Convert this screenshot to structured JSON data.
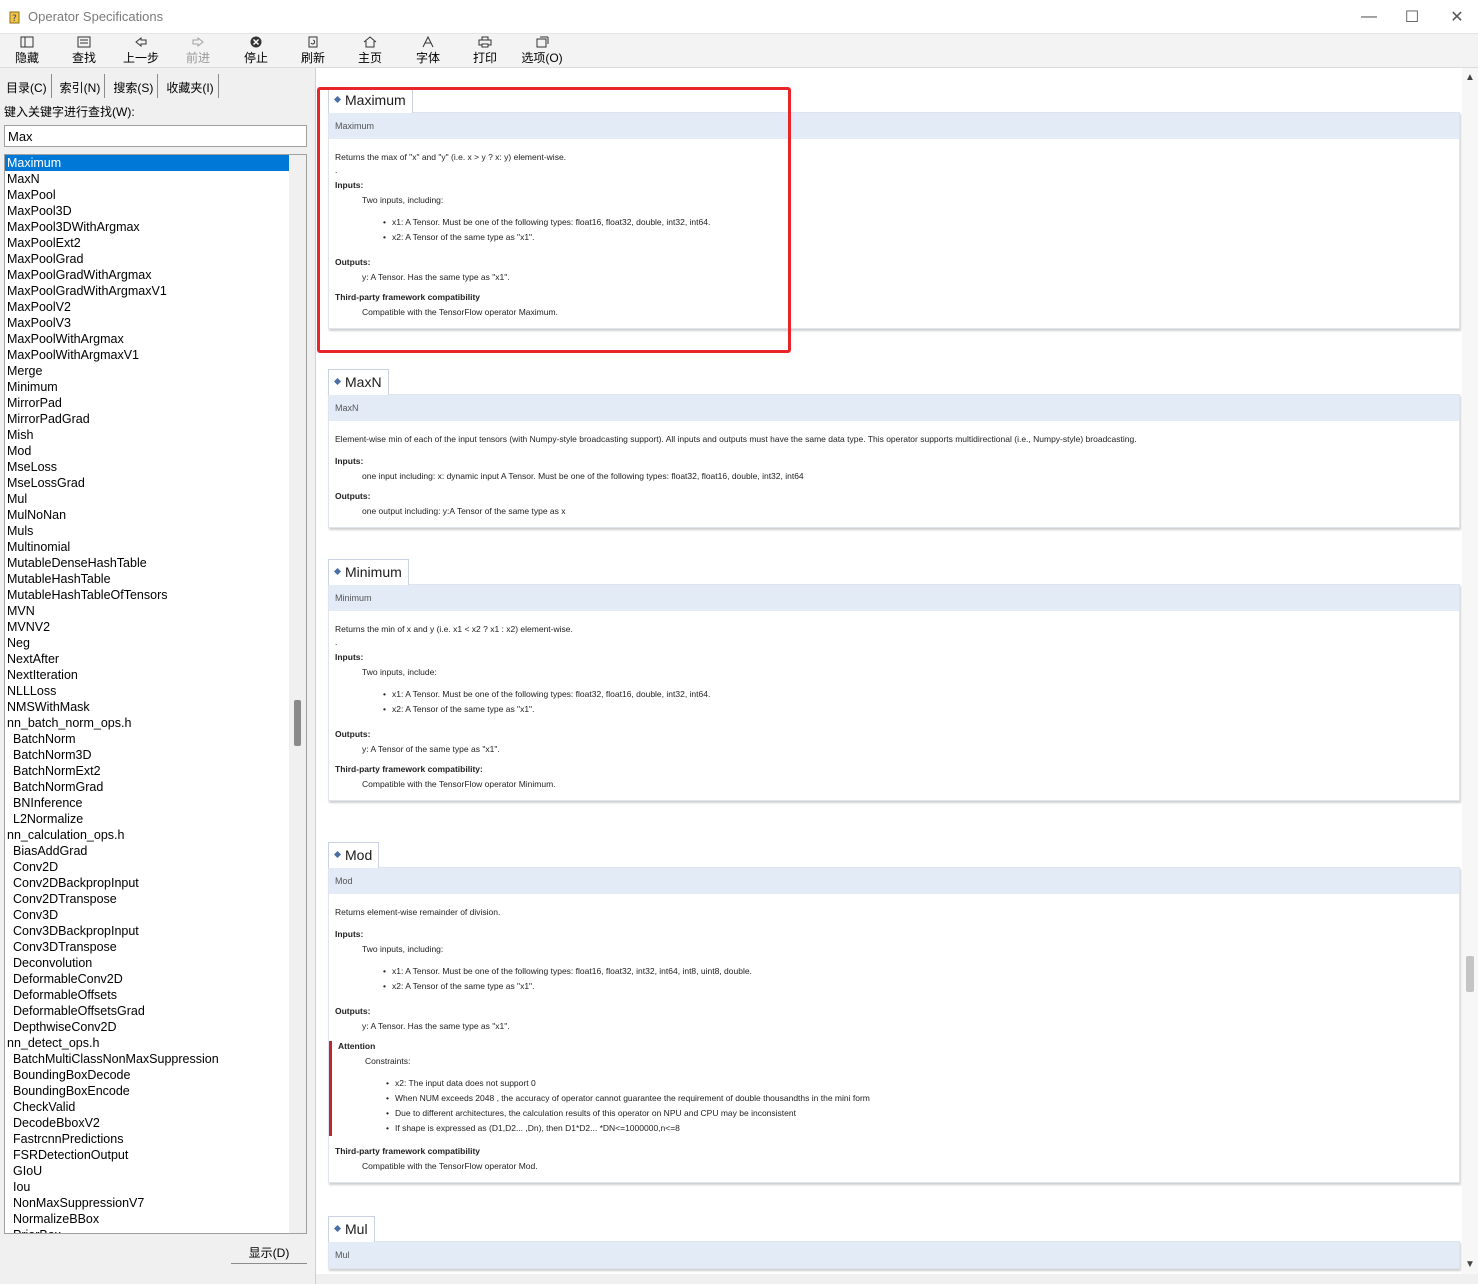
{
  "window": {
    "title": "Operator Specifications",
    "controls": {
      "minimize": "—",
      "maximize": "☐",
      "close": "✕"
    }
  },
  "toolbar": {
    "hide": "隐藏",
    "find": "查找",
    "back": "上一步",
    "forward": "前进",
    "stop": "停止",
    "refresh": "刷新",
    "home": "主页",
    "font": "字体",
    "print": "打印",
    "options": "选项(O)"
  },
  "leftpanel": {
    "tabs": [
      "目录(C)",
      "索引(N)",
      "搜索(S)",
      "收藏夹(I)"
    ],
    "keyword_label": "键入关键字进行查找(W):",
    "search_value": "Max",
    "show_button": "显示(D)",
    "items": [
      {
        "label": "Maximum",
        "selected": true
      },
      {
        "label": "MaxN"
      },
      {
        "label": "MaxPool"
      },
      {
        "label": "MaxPool3D"
      },
      {
        "label": "MaxPool3DWithArgmax"
      },
      {
        "label": "MaxPoolExt2"
      },
      {
        "label": "MaxPoolGrad"
      },
      {
        "label": "MaxPoolGradWithArgmax"
      },
      {
        "label": "MaxPoolGradWithArgmaxV1"
      },
      {
        "label": "MaxPoolV2"
      },
      {
        "label": "MaxPoolV3"
      },
      {
        "label": "MaxPoolWithArgmax"
      },
      {
        "label": "MaxPoolWithArgmaxV1"
      },
      {
        "label": "Merge"
      },
      {
        "label": "Minimum"
      },
      {
        "label": "MirrorPad"
      },
      {
        "label": "MirrorPadGrad"
      },
      {
        "label": "Mish"
      },
      {
        "label": "Mod"
      },
      {
        "label": "MseLoss"
      },
      {
        "label": "MseLossGrad"
      },
      {
        "label": "Mul"
      },
      {
        "label": "MulNoNan"
      },
      {
        "label": "Muls"
      },
      {
        "label": "Multinomial"
      },
      {
        "label": "MutableDenseHashTable"
      },
      {
        "label": "MutableHashTable"
      },
      {
        "label": "MutableHashTableOfTensors"
      },
      {
        "label": "MVN"
      },
      {
        "label": "MVNV2"
      },
      {
        "label": "Neg"
      },
      {
        "label": "NextAfter"
      },
      {
        "label": "NextIteration"
      },
      {
        "label": "NLLLoss"
      },
      {
        "label": "NMSWithMask"
      },
      {
        "label": "nn_batch_norm_ops.h"
      },
      {
        "label": "BatchNorm",
        "sub": true
      },
      {
        "label": "BatchNorm3D",
        "sub": true
      },
      {
        "label": "BatchNormExt2",
        "sub": true
      },
      {
        "label": "BatchNormGrad",
        "sub": true
      },
      {
        "label": "BNInference",
        "sub": true
      },
      {
        "label": "L2Normalize",
        "sub": true
      },
      {
        "label": "nn_calculation_ops.h"
      },
      {
        "label": "BiasAddGrad",
        "sub": true
      },
      {
        "label": "Conv2D",
        "sub": true
      },
      {
        "label": "Conv2DBackpropInput",
        "sub": true
      },
      {
        "label": "Conv2DTranspose",
        "sub": true
      },
      {
        "label": "Conv3D",
        "sub": true
      },
      {
        "label": "Conv3DBackpropInput",
        "sub": true
      },
      {
        "label": "Conv3DTranspose",
        "sub": true
      },
      {
        "label": "Deconvolution",
        "sub": true
      },
      {
        "label": "DeformableConv2D",
        "sub": true
      },
      {
        "label": "DeformableOffsets",
        "sub": true
      },
      {
        "label": "DeformableOffsetsGrad",
        "sub": true
      },
      {
        "label": "DepthwiseConv2D",
        "sub": true
      },
      {
        "label": "nn_detect_ops.h"
      },
      {
        "label": "BatchMultiClassNonMaxSuppression",
        "sub": true
      },
      {
        "label": "BoundingBoxDecode",
        "sub": true
      },
      {
        "label": "BoundingBoxEncode",
        "sub": true
      },
      {
        "label": "CheckValid",
        "sub": true
      },
      {
        "label": "DecodeBboxV2",
        "sub": true
      },
      {
        "label": "FastrcnnPredictions",
        "sub": true
      },
      {
        "label": "FSRDetectionOutput",
        "sub": true
      },
      {
        "label": "GIoU",
        "sub": true
      },
      {
        "label": "Iou",
        "sub": true
      },
      {
        "label": "NonMaxSuppressionV7",
        "sub": true
      },
      {
        "label": "NormalizeBBox",
        "sub": true
      },
      {
        "label": "PriorBox",
        "sub": true
      }
    ]
  },
  "content": {
    "maximum": {
      "tab": "Maximum",
      "head": "Maximum",
      "desc": "Returns the max of \"x\" and \"y\" (i.e. x > y ? x: y) element-wise.",
      "dot": ".",
      "inputs_h": "Inputs:",
      "inputs_text": "Two inputs, including:",
      "inputs_list": [
        "x1: A Tensor. Must be one of the following types: float16, float32, double, int32, int64.",
        "x2: A Tensor of the same type as \"x1\"."
      ],
      "outputs_h": "Outputs:",
      "outputs_text": "y: A Tensor. Has the same type as \"x1\".",
      "compat_h": "Third-party framework compatibility",
      "compat_text": "Compatible with the TensorFlow operator Maximum."
    },
    "maxn": {
      "tab": "MaxN",
      "head": "MaxN",
      "desc": "Element-wise min of each of the input tensors (with Numpy-style broadcasting support). All inputs and outputs must have the same data type. This operator supports multidirectional (i.e., Numpy-style) broadcasting.",
      "inputs_h": "Inputs:",
      "inputs_text": "one input including: x: dynamic input A Tensor. Must be one of the following types: float32, float16, double, int32, int64",
      "outputs_h": "Outputs:",
      "outputs_text": "one output including: y:A Tensor of the same type as x"
    },
    "minimum": {
      "tab": "Minimum",
      "head": "Minimum",
      "desc": "Returns the min of x and y (i.e. x1 < x2 ? x1 : x2) element-wise.",
      "dot": ".",
      "inputs_h": "Inputs:",
      "inputs_text": "Two inputs, include:",
      "inputs_list": [
        "x1: A Tensor. Must be one of the following types: float32, float16, double, int32, int64.",
        "x2: A Tensor of the same type as \"x1\"."
      ],
      "outputs_h": "Outputs:",
      "outputs_text": "y: A Tensor of the same type as \"x1\".",
      "compat_h": "Third-party framework compatibility:",
      "compat_text": "Compatible with the TensorFlow operator Minimum."
    },
    "mod": {
      "tab": "Mod",
      "head": "Mod",
      "desc": "Returns element-wise remainder of division.",
      "inputs_h": "Inputs:",
      "inputs_text": "Two inputs, including:",
      "inputs_list": [
        "x1: A Tensor. Must be one of the following types: float16, float32, int32, int64, int8, uint8, double.",
        "x2: A Tensor of the same type as \"x1\"."
      ],
      "outputs_h": "Outputs:",
      "outputs_text": "y: A Tensor. Has the same type as \"x1\".",
      "attention_h": "Attention",
      "attention_text": "Constraints:",
      "attention_list": [
        "x2: The input data does not support 0",
        "When NUM exceeds 2048 , the accuracy of operator cannot guarantee the requirement of double thousandths in the mini form",
        "Due to different architectures, the calculation results of this operator on NPU and CPU may be inconsistent",
        "If shape is expressed as (D1,D2... ,Dn), then D1*D2... *DN<=1000000,n<=8"
      ],
      "compat_h": "Third-party framework compatibility",
      "compat_text": "Compatible with the TensorFlow operator Mod."
    },
    "mul": {
      "tab": "Mul",
      "head": "Mul"
    }
  },
  "colors": {
    "highlight": "#e8262a",
    "selection": "#0078d7",
    "section_head": "#e3ebf6",
    "attention_bar": "#c0262d"
  }
}
